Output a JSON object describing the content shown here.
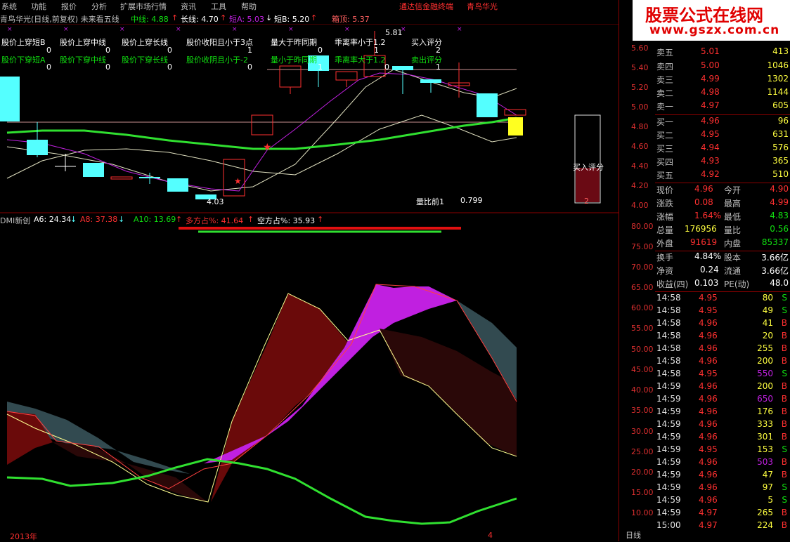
{
  "menu": {
    "items": [
      "系统",
      "功能",
      "报价",
      "分析",
      "扩展市场行情",
      "资讯",
      "工具",
      "帮助"
    ],
    "brand": "通达信金融终端",
    "stock": "青鸟华光"
  },
  "logo": {
    "title": "股票公式在线网",
    "url": "www.gszx.com.cn"
  },
  "title": {
    "name": "青鸟华光(日线,前复权) 未来看五线",
    "mid_label": "中线: 4.88",
    "long_label": "长线: 4.70",
    "shortA": "短A: 5.03",
    "shortB": "短B: 5.20",
    "box_top": "箱顶: 5.37"
  },
  "signals": {
    "row1": [
      "股价上穿短B",
      "股价上穿中线",
      "股价上穿长线",
      "股价收阳且小于3点",
      "量大于昨同期",
      "乖离率小于1.2",
      "买入评分"
    ],
    "row1_vals": [
      "0",
      "0",
      "0",
      "1",
      "0",
      "1",
      "2"
    ],
    "row2": [
      "股价下穿短A",
      "股价下穿中线",
      "股价下穿长线",
      "股价收阴且小于-2",
      "量小于昨同期",
      "乖离率大于1.2",
      "卖出评分"
    ],
    "row2_vals": [
      "0",
      "0",
      "0",
      "0",
      "1",
      "0",
      "1"
    ]
  },
  "annotations": {
    "high": "5.81",
    "low": "4.03",
    "vol_ratio_label": "量比前1",
    "vol_ratio_value": "0.799",
    "buy_score_label": "买入评分",
    "buy_score_value": "2"
  },
  "price_axis": [
    "5.60",
    "5.40",
    "5.20",
    "5.00",
    "4.80",
    "4.60",
    "4.40",
    "4.20",
    "4.00"
  ],
  "dmi": {
    "name": "DMI新创",
    "a6": "A6: 24.34",
    "a8": "A8: 37.38",
    "a10": "A10: 13.69",
    "bull": "多方占%: 41.64",
    "bear": "空方占%: 35.93"
  },
  "dmi_axis": [
    "80.00",
    "75.00",
    "70.00",
    "65.00",
    "60.00",
    "55.00",
    "50.00",
    "45.00",
    "40.00",
    "35.00",
    "30.00",
    "25.00",
    "20.00",
    "15.00",
    "10.00"
  ],
  "quote": {
    "asks": [
      [
        "卖五",
        "5.01",
        "413"
      ],
      [
        "卖四",
        "5.00",
        "1046"
      ],
      [
        "卖三",
        "4.99",
        "1302"
      ],
      [
        "卖二",
        "4.98",
        "1144"
      ],
      [
        "卖一",
        "4.97",
        "605"
      ]
    ],
    "bids": [
      [
        "买一",
        "4.96",
        "96"
      ],
      [
        "买二",
        "4.95",
        "631"
      ],
      [
        "买三",
        "4.94",
        "576"
      ],
      [
        "买四",
        "4.93",
        "365"
      ],
      [
        "买五",
        "4.92",
        "510"
      ]
    ],
    "stats": [
      [
        "现价",
        "4.96",
        "今开",
        "4.90"
      ],
      [
        "涨跌",
        "0.08",
        "最高",
        "4.99"
      ],
      [
        "涨幅",
        "1.64%",
        "最低",
        "4.83"
      ],
      [
        "总量",
        "176956",
        "量比",
        "0.56"
      ],
      [
        "外盘",
        "91619",
        "内盘",
        "85337"
      ]
    ],
    "stats2": [
      [
        "换手",
        "4.84%",
        "股本",
        "3.66亿"
      ],
      [
        "净资",
        "0.24",
        "流通",
        "3.66亿"
      ],
      [
        "收益(四)",
        "0.103",
        "PE(动)",
        "48.0"
      ]
    ]
  },
  "ticks": [
    [
      "14:58",
      "4.95",
      "80",
      "S"
    ],
    [
      "14:58",
      "4.95",
      "49",
      "S"
    ],
    [
      "14:58",
      "4.96",
      "41",
      "B"
    ],
    [
      "14:58",
      "4.96",
      "20",
      "B"
    ],
    [
      "14:58",
      "4.96",
      "255",
      "B"
    ],
    [
      "14:58",
      "4.96",
      "200",
      "B"
    ],
    [
      "14:58",
      "4.95",
      "550",
      "S"
    ],
    [
      "14:59",
      "4.96",
      "200",
      "B"
    ],
    [
      "14:59",
      "4.96",
      "650",
      "B"
    ],
    [
      "14:59",
      "4.96",
      "176",
      "B"
    ],
    [
      "14:59",
      "4.96",
      "333",
      "B"
    ],
    [
      "14:59",
      "4.96",
      "301",
      "B"
    ],
    [
      "14:59",
      "4.95",
      "153",
      "S"
    ],
    [
      "14:59",
      "4.96",
      "503",
      "B"
    ],
    [
      "14:59",
      "4.96",
      "47",
      "B"
    ],
    [
      "14:59",
      "4.96",
      "97",
      "S"
    ],
    [
      "14:59",
      "4.96",
      "5",
      "S"
    ],
    [
      "14:59",
      "4.97",
      "265",
      "B"
    ],
    [
      "15:00",
      "4.97",
      "224",
      "B"
    ]
  ],
  "bottom": {
    "year": "2013年",
    "marker": "4",
    "period": "日线"
  },
  "colors": {
    "up": "#ff3030",
    "down": "#54ffff",
    "green": "#10e010",
    "purple": "#c020e0",
    "yellow": "#ffff40"
  }
}
